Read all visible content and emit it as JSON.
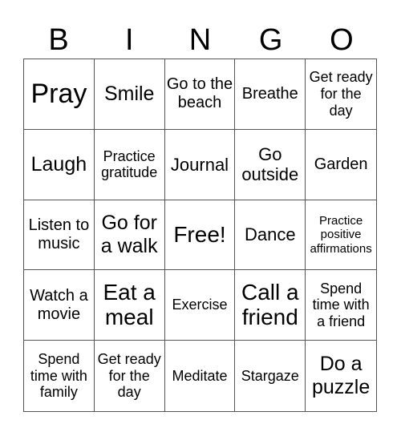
{
  "header": {
    "letters": [
      "B",
      "I",
      "N",
      "G",
      "O"
    ]
  },
  "cells": [
    "Pray",
    "Smile",
    "Go to the beach",
    "Breathe",
    "Get ready for the day",
    "Laugh",
    "Practice gratitude",
    "Journal",
    "Go outside",
    "Garden",
    "Listen to music",
    "Go for a walk",
    "Free!",
    "Dance",
    "Practice positive affirmations",
    "Watch a movie",
    "Eat a meal",
    "Exercise",
    "Call a friend",
    "Spend time with a friend",
    "Spend time with family",
    "Get ready for the day",
    "Meditate",
    "Stargaze",
    "Do a puzzle"
  ]
}
